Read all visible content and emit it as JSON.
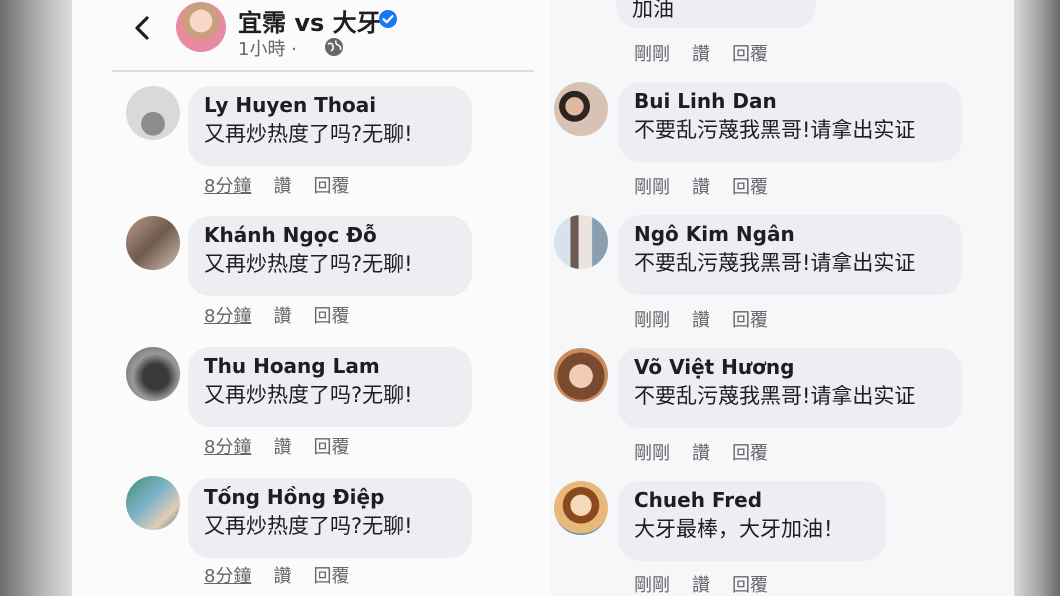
{
  "post": {
    "title": "宜霈 vs 大牙",
    "meta": "1小時 ·"
  },
  "actions": {
    "like": "讚",
    "reply": "回覆"
  },
  "left_comments": [
    {
      "author": "Ly Huyen Thoai",
      "text": "又再炒热度了吗?无聊!",
      "time": "8分鐘"
    },
    {
      "author": "Khánh Ngọc Đỗ",
      "text": "又再炒热度了吗?无聊!",
      "time": "8分鐘"
    },
    {
      "author": "Thu Hoang Lam",
      "text": "又再炒热度了吗?无聊!",
      "time": "8分鐘"
    },
    {
      "author": "Tống Hồng Điệp",
      "text": "又再炒热度了吗?无聊!",
      "time": "8分鐘"
    }
  ],
  "right_top": {
    "text": "加油",
    "time": "剛剛"
  },
  "right_comments": [
    {
      "author": "Bui Linh Dan",
      "text": "不要乱污蔑我黑哥!请拿出实证",
      "time": "剛剛"
    },
    {
      "author": "Ngô Kim Ngân",
      "text": "不要乱污蔑我黑哥!请拿出实证",
      "time": "剛剛"
    },
    {
      "author": "Võ Việt Hương",
      "text": "不要乱污蔑我黑哥!请拿出实证",
      "time": "剛剛"
    },
    {
      "author": "Chueh Fred",
      "text": "大牙最棒，大牙加油！",
      "time": "剛剛"
    }
  ]
}
